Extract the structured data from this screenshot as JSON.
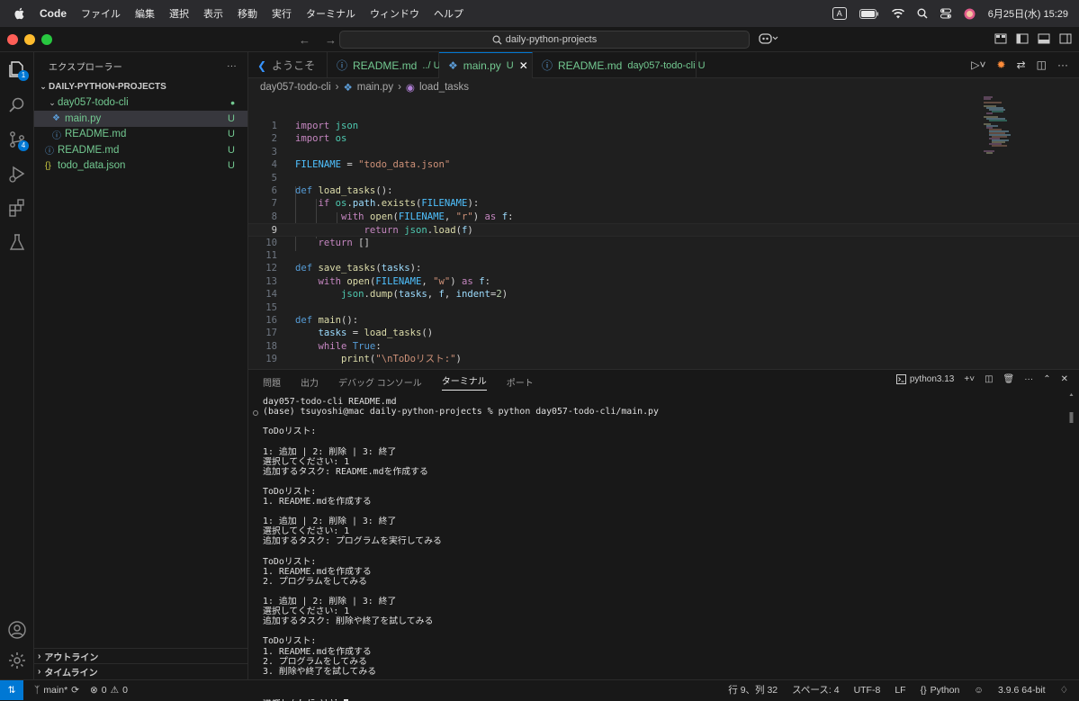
{
  "menubar": {
    "app_name": "Code",
    "items": [
      "ファイル",
      "編集",
      "選択",
      "表示",
      "移動",
      "実行",
      "ターミナル",
      "ウィンドウ",
      "ヘルプ"
    ],
    "ime": "A",
    "datetime": "6月25日(水)  15:29"
  },
  "titlebar": {
    "search_text": "daily-python-projects"
  },
  "activity": {
    "explorer_badge": "1",
    "scm_badge": "4"
  },
  "sidebar": {
    "title": "エクスプローラー",
    "more": "···",
    "root": "DAILY-PYTHON-PROJECTS",
    "folder": "day057-todo-cli",
    "files": [
      {
        "name": "main.py",
        "status": "U"
      },
      {
        "name": "README.md",
        "status": "U"
      },
      {
        "name": "README.md",
        "status": "U"
      },
      {
        "name": "todo_data.json",
        "status": "U"
      }
    ],
    "outline": "アウトライン",
    "timeline": "タイムライン"
  },
  "tabs": [
    {
      "label": "ようこそ"
    },
    {
      "label": "README.md",
      "hint": "../ U"
    },
    {
      "label": "main.py",
      "hint": "U"
    },
    {
      "label": "README.md",
      "hint": "day057-todo-cli U"
    }
  ],
  "breadcrumb": {
    "folder": "day057-todo-cli",
    "file": "main.py",
    "symbol": "load_tasks"
  },
  "editor": {
    "line_numbers": [
      "1",
      "2",
      "3",
      "4",
      "5",
      "6",
      "7",
      "8",
      "9",
      "10",
      "11",
      "12",
      "13",
      "14",
      "15",
      "16",
      "17",
      "18",
      "19"
    ]
  },
  "panel": {
    "tabs": [
      "問題",
      "出力",
      "デバッグ コンソール",
      "ターミナル",
      "ポート"
    ],
    "shell": "python3.13",
    "terminal_lines": [
      "day057-todo-cli README.md",
      "(base) tsuyoshi@mac daily-python-projects % python day057-todo-cli/main.py",
      "",
      "ToDoリスト:",
      "",
      "1: 追加 | 2: 削除 | 3: 終了",
      "選択してください: 1",
      "追加するタスク: README.mdを作成する",
      "",
      "ToDoリスト:",
      "1. README.mdを作成する",
      "",
      "1: 追加 | 2: 削除 | 3: 終了",
      "選択してください: 1",
      "追加するタスク: プログラムを実行してみる",
      "",
      "ToDoリスト:",
      "1. README.mdを作成する",
      "2. プログラムをしてみる",
      "",
      "1: 追加 | 2: 削除 | 3: 終了",
      "選択してください: 1",
      "追加するタスク: 削除や終了を試してみる",
      "",
      "ToDoリスト:",
      "1. README.mdを作成する",
      "2. プログラムをしてみる",
      "3. 削除や終了を試してみる",
      "",
      "1: 追加 | 2: 削除 | 3: 終了",
      "選択してください: "
    ]
  },
  "statusbar": {
    "branch": "main*",
    "errors": "0",
    "warnings": "0",
    "position": "行 9、列 32",
    "spaces": "スペース: 4",
    "encoding": "UTF-8",
    "eol": "LF",
    "language": "Python",
    "interpreter": "3.9.6 64-bit"
  },
  "colors": {
    "accent": "#0078d4",
    "untracked": "#73c991"
  }
}
